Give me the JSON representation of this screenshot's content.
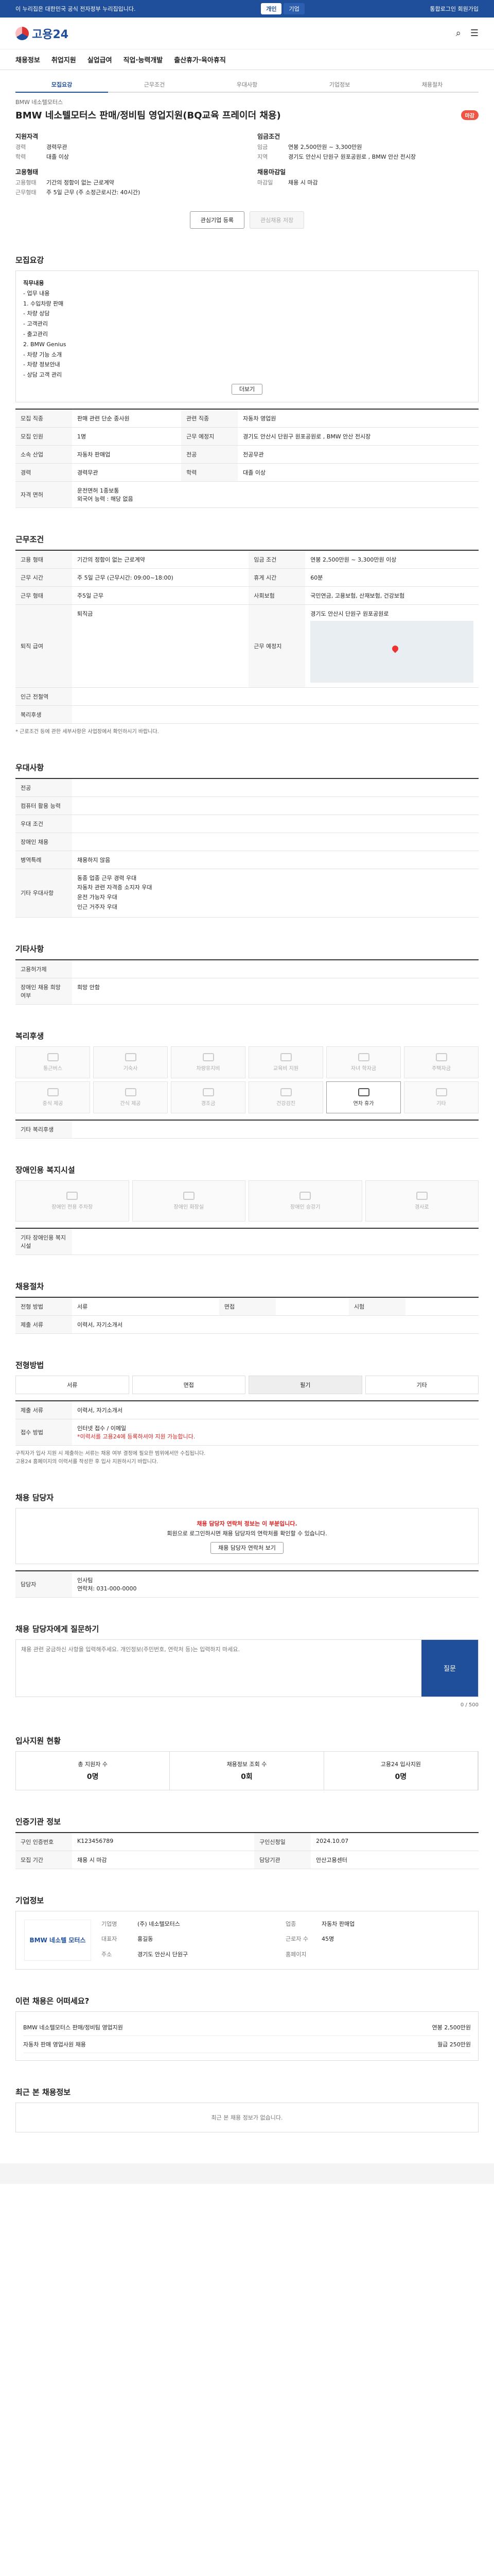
{
  "topbar": {
    "notice": "이 누리집은 대한민국 공식 전자정부 누리집입니다.",
    "tabs": [
      "개인",
      "기업"
    ],
    "right": "통합로그인 회원가입"
  },
  "header": {
    "logo": "고용24"
  },
  "gnb": [
    "채용정보",
    "취업지원",
    "실업급여",
    "직업·능력개발",
    "출산휴가·육아휴직"
  ],
  "steps": [
    "모집요강",
    "근무조건",
    "우대사항",
    "기업정보",
    "채용절차"
  ],
  "job": {
    "crumb": "BMW 네소텔모터스",
    "title": "BMW 네소텔모터스 판매/정비팀 영업지원(BQ교육 프레이더 채용)",
    "badge": "마감",
    "summary": {
      "career_lbl": "지원자격",
      "career": [
        [
          "경력",
          "경력무관"
        ],
        [
          "학력",
          "대졸 이상"
        ]
      ],
      "pay_lbl": "임금조건",
      "pay": [
        [
          "임금",
          "연봉 2,500만원 ~ 3,300만원"
        ],
        [
          "지역",
          "경기도 안산시 단원구 원포공원로 , BMW 안산 전시장"
        ]
      ],
      "type_lbl": "고용형태",
      "type": [
        [
          "고용형태",
          "기간의 정함이 없는 근로계약"
        ],
        [
          "근무형태",
          "주 5일 근무 (주 소정근로시간: 40시간)"
        ]
      ],
      "deadline_lbl": "채용마감일",
      "deadline": [
        [
          "마감일",
          "채용 시 마감"
        ]
      ]
    }
  },
  "buttons": {
    "apply": "인터넷 접수",
    "bookmark": "관심채용 저장",
    "fav": "관심기업 등록"
  },
  "recruit": {
    "title": "모집요강",
    "duty_lbl": "직무내용",
    "duties": [
      "- 업무 내용",
      "1. 수입차량 판매",
      "- 차량 상담",
      "- 고객관리",
      "- 출고관리",
      "2. BMW Genius",
      "- 차량 기능 소개",
      "- 차량 정보안내",
      "- 상담 고객 관리"
    ],
    "more": "더보기",
    "rows": [
      [
        "모집 직종",
        "판매 관련 단순 종사원",
        "관련 직종",
        "자동차 영업원"
      ],
      [
        "모집 인원",
        "1명",
        "근무 예정지",
        "경기도 안산시 단원구 원포공원로 , BMW 안산 전시장"
      ],
      [
        "소속 산업",
        "자동차 판매업",
        "전공",
        "전공무관"
      ],
      [
        "경력",
        "경력무관",
        "학력",
        "대졸 이상"
      ],
      [
        "자격 면허",
        "운전면허 1종보통",
        "",
        ""
      ]
    ],
    "lang": "외국어 능력 : 해당 없음"
  },
  "conditions": {
    "title": "근무조건",
    "rows": [
      [
        "고용 형태",
        "기간의 정함이 없는 근로계약",
        "임금 조건",
        "연봉 2,500만원 ~ 3,300만원 이상"
      ],
      [
        "근무 시간",
        "주 5일 근무 (근무시간: 09:00~18:00)",
        "휴게 시간",
        "60분"
      ],
      [
        "근무 형태",
        "주5일 근무",
        "사회보험",
        "국민연금, 고용보험, 산재보험, 건강보험"
      ],
      [
        "퇴직 급여",
        "퇴직금",
        "근무 예정지",
        "경기도 안산시 단원구 원포공원로"
      ],
      [
        "인근 전철역",
        "",
        "",
        ""
      ],
      [
        "복리후생",
        "",
        "",
        ""
      ]
    ],
    "note": "* 근로조건 등에 관한 세부사항은 사업장에서 확인하시기 바랍니다."
  },
  "pref": {
    "title": "우대사항",
    "rows": [
      [
        "전공",
        ""
      ],
      [
        "컴퓨터 활용 능력",
        ""
      ],
      [
        "우대 조건",
        ""
      ],
      [
        "장애인 채용",
        ""
      ],
      [
        "병역특례",
        "채용하지 않음"
      ],
      [
        "기타 우대사항",
        "동종 업종 근무 경력 우대\n자동차 관련 자격증 소지자 우대\n운전 가능자 우대\n인근 거주자 우대"
      ]
    ]
  },
  "other": {
    "title": "기타사항",
    "rows": [
      [
        "고용허가제",
        ""
      ],
      [
        "장애인 채용 희망 여부",
        "희망 안함"
      ]
    ]
  },
  "welfare": {
    "title": "복리후생",
    "items": [
      "통근버스",
      "기숙사",
      "차량유지비",
      "교육비 지원",
      "자녀 학자금",
      "주택자금",
      "중식 제공",
      "간식 제공",
      "경조금",
      "건강검진",
      "연차 휴가",
      "기타"
    ],
    "etc_lbl": "기타 복리후생",
    "etc": ""
  },
  "disability": {
    "title": "장애인용 복지시설",
    "items": [
      "장애인 전용 주차장",
      "장애인 화장실",
      "장애인 승강기",
      "경사로"
    ],
    "etc_lbl": "기타 장애인용 복지시설",
    "etc": ""
  },
  "process": {
    "title": "채용절차",
    "rows": [
      [
        "전형 방법",
        "서류",
        "면접",
        "",
        "시험",
        ""
      ],
      [
        "제출 서류",
        "이력서, 자기소개서",
        "",
        "",
        "",
        ""
      ]
    ]
  },
  "apply": {
    "title": "전형방법",
    "methods": [
      "서류",
      "면접",
      "필기",
      "기타"
    ],
    "pick": "필기",
    "doc_lbl": "제출 서류",
    "doc": "이력서, 자기소개서",
    "method_lbl": "접수 방법",
    "method": "인터넷 접수 / 이메일",
    "etc": "*이력서를 고용24에 등록하셔야 지원 가능합니다.",
    "notes": [
      "구직자가 입사 지원 시 제출하는 서류는 채용 여부 결정에 필요한 범위에서만 수집됩니다.",
      "고용24 홈페이지의 이력서를 작성한 후 입사 지원하시기 바랍니다."
    ]
  },
  "contact": {
    "title": "채용 담당자",
    "alert": "채용 담당자 연락처 정보는 이 부분입니다.",
    "alert_sub": "회원으로 로그인하시면 채용 담당자의 연락처를 확인할 수 있습니다.",
    "btn": "채용 담당자 연락처 보기",
    "person_lbl": "담당자",
    "person": "인사팀",
    "phone": "연락처: 031-000-0000"
  },
  "qna": {
    "title": "채용 담당자에게 질문하기",
    "placeholder": "채용 관련 궁금하신 사항을 입력해주세요. 개인정보(주민번호, 연락처 등)는 입력하지 마세요.",
    "send": "질문",
    "count": "0 / 500"
  },
  "status": {
    "title": "입사지원 현황",
    "items": [
      [
        "총 지원자 수",
        "0명"
      ],
      [
        "채용정보 조회 수",
        "0회"
      ],
      [
        "고용24 입사지원",
        "0명"
      ]
    ]
  },
  "info": {
    "title": "인증기관 정보",
    "rows": [
      [
        "구인 인증번호",
        "K123456789",
        "구인신청일",
        "2024.10.07"
      ],
      [
        "모집 기간",
        "채용 시 마감",
        "담당기관",
        "안산고용센터"
      ]
    ]
  },
  "company": {
    "title": "기업정보",
    "name": "BMW 네소텔 모터스",
    "rows": [
      [
        "기업명",
        "(주) 네소텔모터스",
        "업종",
        "자동차 판매업"
      ],
      [
        "대표자",
        "홍길동",
        "근로자 수",
        "45명"
      ],
      [
        "주소",
        "경기도 안산시 단원구",
        "홈페이지",
        ""
      ]
    ]
  },
  "similar": {
    "title": "이런 채용은 어떠세요?",
    "items": [
      [
        "BMW 네소텔모터스 판매/정비팀 영업지원",
        "연봉 2,500만원"
      ],
      [
        "자동차 판매 영업사원 채용",
        "월급 250만원"
      ]
    ]
  },
  "recent": {
    "title": "최근 본 채용정보",
    "empty": "최근 본 채용 정보가 없습니다."
  }
}
